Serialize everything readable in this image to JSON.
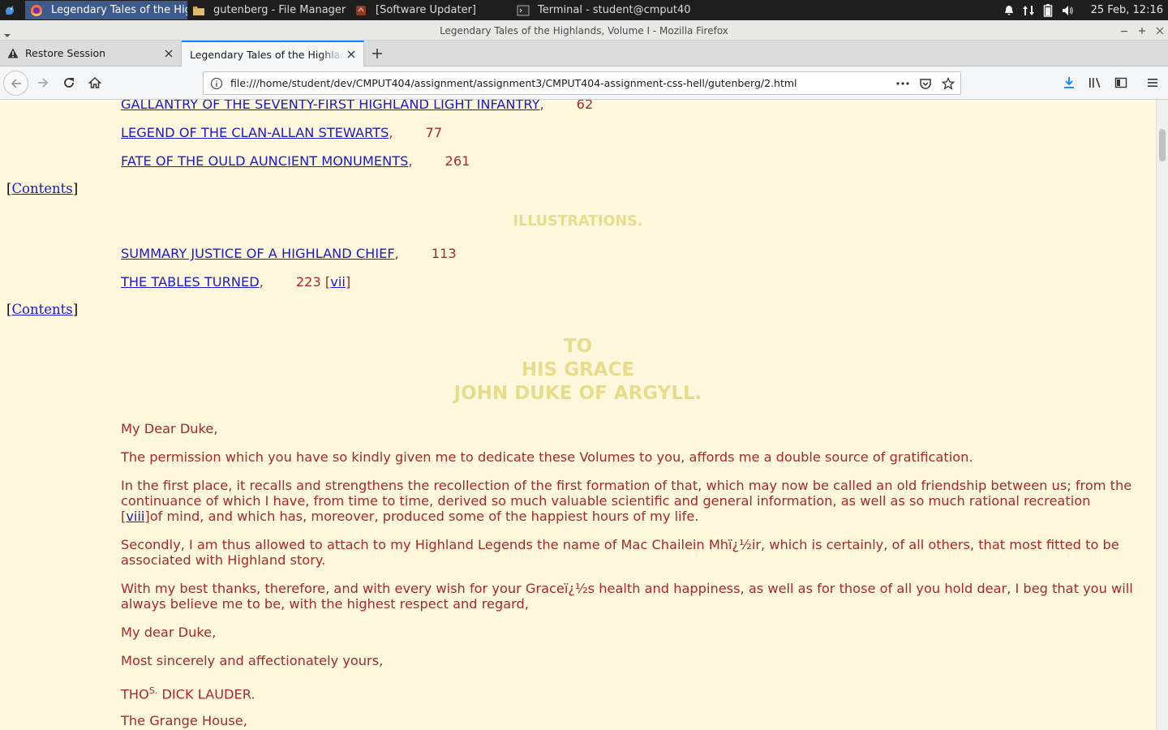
{
  "panel": {
    "tasks": [
      {
        "label": "Legendary Tales of the Highl...",
        "icon": "firefox-icon",
        "active": true
      },
      {
        "label": "gutenberg - File Manager",
        "icon": "folder-icon",
        "active": false
      },
      {
        "label": "[Software Updater]",
        "icon": "software-updater-icon",
        "active": false
      },
      {
        "label": "Terminal - student@cmput40...",
        "icon": "terminal-icon",
        "active": false
      }
    ],
    "clock": "25 Feb, 12:16"
  },
  "window": {
    "title": "Legendary Tales of the Highlands, Volume I - Mozilla Firefox"
  },
  "tabs": [
    {
      "label": "Restore Session"
    },
    {
      "label": "Legendary Tales of the Highlands"
    }
  ],
  "navbar": {
    "url": "file:///home/student/dev/CMPUT404/assignment/assignment3/CMPUT404-assignment-css-hell/gutenberg/2.html"
  },
  "page": {
    "toc": [
      {
        "title": "GALLANTRY OF THE SEVENTY-FIRST HIGHLAND LIGHT INFANTRY",
        "page": "62"
      },
      {
        "title": "LEGEND OF THE CLAN-ALLAN STEWARTS",
        "page": "77"
      },
      {
        "title": "FATE OF THE OULD AUNCIENT MONUMENTS",
        "page": "261"
      }
    ],
    "contents_label": "Contents",
    "illustrations_heading": "ILLUSTRATIONS.",
    "illustrations": [
      {
        "title": "SUMMARY JUSTICE OF A HIGHLAND CHIEF",
        "page": "113"
      },
      {
        "title": "THE TABLES TURNED",
        "page": "223",
        "page_marker": "vii"
      }
    ],
    "dedication": {
      "line1": "TO",
      "line2": "HIS GRACE",
      "line3": "JOHN DUKE OF ARGYLL."
    },
    "letter": {
      "salutation": "My Dear Duke,",
      "p1": "The permission which you have so kindly given me to dedicate these Volumes to you, affords me a double source of gratification.",
      "p2a": "In the first place, it recalls and strengthens the recollection of the first formation of that, which may now be called an old friendship between us; from the continuance of which I have, from time to time, derived so much valuable scientific and general information, as well as so much rational recreation ",
      "p2_marker": "viii",
      "p2b": "of mind, and which has, moreover, produced some of the happiest hours of my life.",
      "p3": "Secondly, I am thus allowed to attach to my Highland Legends the name of Mac Chailein Mhï¿½ir, which is certainly, of all others, that most fitted to be associated with Highland story.",
      "p4": "With my best thanks, therefore, and with every wish for your Graceï¿½s health and happiness, as well as for those of all you hold dear, I beg that you will always believe me to be, with the highest respect and regard,",
      "closing1": "My dear Duke,",
      "closing2": "Most sincerely and affectionately yours,",
      "sig_a": "THO",
      "sig_sup": "S.",
      "sig_b": " DICK LAUDER.",
      "place": "The Grange House,"
    }
  }
}
